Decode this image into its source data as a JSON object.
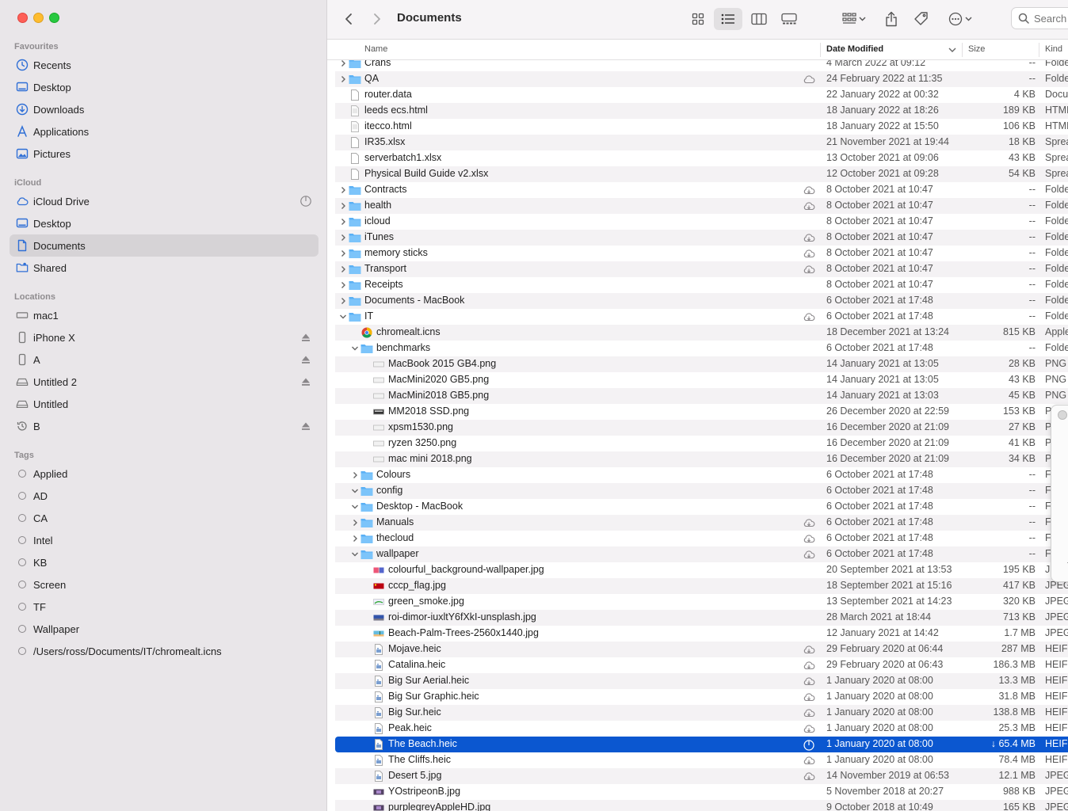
{
  "sidebar": {
    "favourites_title": "Favourites",
    "favourites": [
      {
        "label": "Recents",
        "icon": "clock-icon"
      },
      {
        "label": "Desktop",
        "icon": "desktop-icon"
      },
      {
        "label": "Downloads",
        "icon": "download-icon"
      },
      {
        "label": "Applications",
        "icon": "applications-icon"
      },
      {
        "label": "Pictures",
        "icon": "pictures-icon"
      }
    ],
    "icloud_title": "iCloud",
    "icloud": [
      {
        "label": "iCloud Drive",
        "icon": "cloud-icon"
      },
      {
        "label": "Desktop",
        "icon": "desktop-icon"
      },
      {
        "label": "Documents",
        "icon": "document-icon"
      },
      {
        "label": "Shared",
        "icon": "shared-folder-icon"
      }
    ],
    "locations_title": "Locations",
    "locations": [
      {
        "label": "mac1",
        "icon": "computer-icon",
        "eject": false
      },
      {
        "label": "iPhone X",
        "icon": "iphone-icon",
        "eject": true
      },
      {
        "label": "A",
        "icon": "iphone-icon",
        "eject": true
      },
      {
        "label": "Untitled 2",
        "icon": "disk-icon",
        "eject": true
      },
      {
        "label": "Untitled",
        "icon": "disk-icon",
        "eject": false
      },
      {
        "label": "B",
        "icon": "time-machine-icon",
        "eject": true
      }
    ],
    "tags_title": "Tags",
    "tags": [
      "Applied",
      "AD",
      "CA",
      "Intel",
      "KB",
      "Screen",
      "TF",
      "Wallpaper",
      "/Users/ross/Documents/IT/chromealt.icns"
    ]
  },
  "toolbar": {
    "title": "Documents",
    "search_placeholder": "Search"
  },
  "columns": {
    "name": "Name",
    "date_modified": "Date Modified",
    "size": "Size",
    "kind": "Kind"
  },
  "rows": [
    {
      "name": "Crans",
      "date": "4 March 2022 at 09:12",
      "size": "--",
      "kind": "Folder",
      "type": "folder",
      "indent": 0,
      "chevron": "right",
      "cloud": ""
    },
    {
      "name": "QA",
      "date": "24 February 2022 at 11:35",
      "size": "--",
      "kind": "Folder",
      "type": "folder",
      "indent": 0,
      "chevron": "right",
      "cloud": "cloud"
    },
    {
      "name": "router.data",
      "date": "22 January 2022 at 00:32",
      "size": "4 KB",
      "kind": "Document",
      "type": "doc",
      "indent": 0,
      "chevron": "",
      "cloud": ""
    },
    {
      "name": "leeds ecs.html",
      "date": "18 January 2022 at 18:26",
      "size": "189 KB",
      "kind": "HTML",
      "type": "html",
      "indent": 0,
      "chevron": "",
      "cloud": ""
    },
    {
      "name": "itecco.html",
      "date": "18 January 2022 at 15:50",
      "size": "106 KB",
      "kind": "HTML",
      "type": "html",
      "indent": 0,
      "chevron": "",
      "cloud": ""
    },
    {
      "name": "IR35.xlsx",
      "date": "21 November 2021 at 19:44",
      "size": "18 KB",
      "kind": "Spreadsheet",
      "type": "doc",
      "indent": 0,
      "chevron": "",
      "cloud": ""
    },
    {
      "name": "serverbatch1.xlsx",
      "date": "13 October 2021 at 09:06",
      "size": "43 KB",
      "kind": "Spreadsheet",
      "type": "doc",
      "indent": 0,
      "chevron": "",
      "cloud": ""
    },
    {
      "name": "Physical Build Guide v2.xlsx",
      "date": "12 October 2021 at 09:28",
      "size": "54 KB",
      "kind": "Spreadsheet",
      "type": "doc",
      "indent": 0,
      "chevron": "",
      "cloud": ""
    },
    {
      "name": "Contracts",
      "date": "8 October 2021 at 10:47",
      "size": "--",
      "kind": "Folder",
      "type": "folder",
      "indent": 0,
      "chevron": "right",
      "cloud": "download"
    },
    {
      "name": "health",
      "date": "8 October 2021 at 10:47",
      "size": "--",
      "kind": "Folder",
      "type": "folder",
      "indent": 0,
      "chevron": "right",
      "cloud": "download"
    },
    {
      "name": "icloud",
      "date": "8 October 2021 at 10:47",
      "size": "--",
      "kind": "Folder",
      "type": "folder",
      "indent": 0,
      "chevron": "right",
      "cloud": ""
    },
    {
      "name": "iTunes",
      "date": "8 October 2021 at 10:47",
      "size": "--",
      "kind": "Folder",
      "type": "folder",
      "indent": 0,
      "chevron": "right",
      "cloud": "download"
    },
    {
      "name": "memory sticks",
      "date": "8 October 2021 at 10:47",
      "size": "--",
      "kind": "Folder",
      "type": "folder",
      "indent": 0,
      "chevron": "right",
      "cloud": "download"
    },
    {
      "name": "Transport",
      "date": "8 October 2021 at 10:47",
      "size": "--",
      "kind": "Folder",
      "type": "folder",
      "indent": 0,
      "chevron": "right",
      "cloud": "download"
    },
    {
      "name": "Receipts",
      "date": "8 October 2021 at 10:47",
      "size": "--",
      "kind": "Folder",
      "type": "folder",
      "indent": 0,
      "chevron": "right",
      "cloud": ""
    },
    {
      "name": "Documents - MacBook",
      "date": "6 October 2021 at 17:48",
      "size": "--",
      "kind": "Folder",
      "type": "folder",
      "indent": 0,
      "chevron": "right",
      "cloud": ""
    },
    {
      "name": "IT",
      "date": "6 October 2021 at 17:48",
      "size": "--",
      "kind": "Folder",
      "type": "folder",
      "indent": 0,
      "chevron": "down",
      "cloud": "download"
    },
    {
      "name": "chromealt.icns",
      "date": "18 December 2021 at 13:24",
      "size": "815 KB",
      "kind": "Apple",
      "type": "chrome",
      "indent": 1,
      "chevron": "",
      "cloud": ""
    },
    {
      "name": "benchmarks",
      "date": "6 October 2021 at 17:48",
      "size": "--",
      "kind": "Folder",
      "type": "folder",
      "indent": 1,
      "chevron": "down",
      "cloud": ""
    },
    {
      "name": "MacBook 2015 GB4.png",
      "date": "14 January 2021 at 13:05",
      "size": "28 KB",
      "kind": "PNG",
      "type": "png",
      "indent": 2,
      "chevron": "",
      "cloud": ""
    },
    {
      "name": "MacMini2020 GB5.png",
      "date": "14 January 2021 at 13:05",
      "size": "43 KB",
      "kind": "PNG",
      "type": "png",
      "indent": 2,
      "chevron": "",
      "cloud": ""
    },
    {
      "name": "MacMini2018 GB5.png",
      "date": "14 January 2021 at 13:03",
      "size": "45 KB",
      "kind": "PNG",
      "type": "png",
      "indent": 2,
      "chevron": "",
      "cloud": ""
    },
    {
      "name": "MM2018 SSD.png",
      "date": "26 December 2020 at 22:59",
      "size": "153 KB",
      "kind": "P",
      "type": "pngdark",
      "indent": 2,
      "chevron": "",
      "cloud": ""
    },
    {
      "name": "xpsm1530.png",
      "date": "16 December 2020 at 21:09",
      "size": "27 KB",
      "kind": "P",
      "type": "png",
      "indent": 2,
      "chevron": "",
      "cloud": ""
    },
    {
      "name": "ryzen 3250.png",
      "date": "16 December 2020 at 21:09",
      "size": "41 KB",
      "kind": "P",
      "type": "png",
      "indent": 2,
      "chevron": "",
      "cloud": ""
    },
    {
      "name": "mac mini 2018.png",
      "date": "16 December 2020 at 21:09",
      "size": "34 KB",
      "kind": "P",
      "type": "png",
      "indent": 2,
      "chevron": "",
      "cloud": ""
    },
    {
      "name": "Colours",
      "date": "6 October 2021 at 17:48",
      "size": "--",
      "kind": "F",
      "type": "folder",
      "indent": 1,
      "chevron": "right",
      "cloud": ""
    },
    {
      "name": "config",
      "date": "6 October 2021 at 17:48",
      "size": "--",
      "kind": "F",
      "type": "folder",
      "indent": 1,
      "chevron": "down",
      "cloud": ""
    },
    {
      "name": "Desktop - MacBook",
      "date": "6 October 2021 at 17:48",
      "size": "--",
      "kind": "F",
      "type": "folder",
      "indent": 1,
      "chevron": "down",
      "cloud": ""
    },
    {
      "name": "Manuals",
      "date": "6 October 2021 at 17:48",
      "size": "--",
      "kind": "F",
      "type": "folder",
      "indent": 1,
      "chevron": "right",
      "cloud": "download"
    },
    {
      "name": "thecloud",
      "date": "6 October 2021 at 17:48",
      "size": "--",
      "kind": "F",
      "type": "folder",
      "indent": 1,
      "chevron": "right",
      "cloud": "download"
    },
    {
      "name": "wallpaper",
      "date": "6 October 2021 at 17:48",
      "size": "--",
      "kind": "F",
      "type": "folder",
      "indent": 1,
      "chevron": "down",
      "cloud": "download"
    },
    {
      "name": "colourful_background-wallpaper.jpg",
      "date": "20 September 2021 at 13:53",
      "size": "195 KB",
      "kind": "J",
      "type": "jpgcolor",
      "indent": 2,
      "chevron": "",
      "cloud": ""
    },
    {
      "name": "cccp_flag.jpg",
      "date": "18 September 2021 at 15:16",
      "size": "417 KB",
      "kind": "JPEG",
      "type": "jpgred",
      "indent": 2,
      "chevron": "",
      "cloud": ""
    },
    {
      "name": "green_smoke.jpg",
      "date": "13 September 2021 at 14:23",
      "size": "320 KB",
      "kind": "JPEG",
      "type": "jpggreen",
      "indent": 2,
      "chevron": "",
      "cloud": ""
    },
    {
      "name": "roi-dimor-iuxltY6fXkI-unsplash.jpg",
      "date": "28 March 2021 at 18:44",
      "size": "713 KB",
      "kind": "JPEG",
      "type": "jpgblue",
      "indent": 2,
      "chevron": "",
      "cloud": ""
    },
    {
      "name": "Beach-Palm-Trees-2560x1440.jpg",
      "date": "12 January 2021 at 14:42",
      "size": "1.7 MB",
      "kind": "JPEG",
      "type": "jpgbeach",
      "indent": 2,
      "chevron": "",
      "cloud": ""
    },
    {
      "name": "Mojave.heic",
      "date": "29 February 2020 at 06:44",
      "size": "287 MB",
      "kind": "HEIF",
      "type": "heic",
      "indent": 2,
      "chevron": "",
      "cloud": "download"
    },
    {
      "name": "Catalina.heic",
      "date": "29 February 2020 at 06:43",
      "size": "186.3 MB",
      "kind": "HEIF",
      "type": "heic",
      "indent": 2,
      "chevron": "",
      "cloud": "download"
    },
    {
      "name": "Big Sur Aerial.heic",
      "date": "1 January 2020 at 08:00",
      "size": "13.3 MB",
      "kind": "HEIF",
      "type": "heic",
      "indent": 2,
      "chevron": "",
      "cloud": "download"
    },
    {
      "name": "Big Sur Graphic.heic",
      "date": "1 January 2020 at 08:00",
      "size": "31.8 MB",
      "kind": "HEIF",
      "type": "heic",
      "indent": 2,
      "chevron": "",
      "cloud": "download"
    },
    {
      "name": "Big Sur.heic",
      "date": "1 January 2020 at 08:00",
      "size": "138.8 MB",
      "kind": "HEIF",
      "type": "heic",
      "indent": 2,
      "chevron": "",
      "cloud": "download"
    },
    {
      "name": "Peak.heic",
      "date": "1 January 2020 at 08:00",
      "size": "25.3 MB",
      "kind": "HEIF",
      "type": "heic",
      "indent": 2,
      "chevron": "",
      "cloud": "download"
    },
    {
      "name": "The Beach.heic",
      "date": "1 January 2020 at 08:00",
      "size": "↓ 65.4 MB",
      "kind": "HEIF",
      "type": "heic",
      "indent": 2,
      "chevron": "",
      "cloud": "progress",
      "selected": true
    },
    {
      "name": "The Cliffs.heic",
      "date": "1 January 2020 at 08:00",
      "size": "78.4 MB",
      "kind": "HEIF",
      "type": "heic",
      "indent": 2,
      "chevron": "",
      "cloud": "download"
    },
    {
      "name": "Desert 5.jpg",
      "date": "14 November 2019 at 06:53",
      "size": "12.1 MB",
      "kind": "JPEG",
      "type": "heic",
      "indent": 2,
      "chevron": "",
      "cloud": "download"
    },
    {
      "name": "YOstripeonB.jpg",
      "date": "5 November 2018 at 20:27",
      "size": "988 KB",
      "kind": "JPEG",
      "type": "jpgpurple",
      "indent": 2,
      "chevron": "",
      "cloud": ""
    },
    {
      "name": "purplegreyAppleHD.jpg",
      "date": "9 October 2018 at 10:49",
      "size": "165 KB",
      "kind": "JPEG",
      "type": "jpgpurple",
      "indent": 2,
      "chevron": "",
      "cloud": ""
    }
  ]
}
